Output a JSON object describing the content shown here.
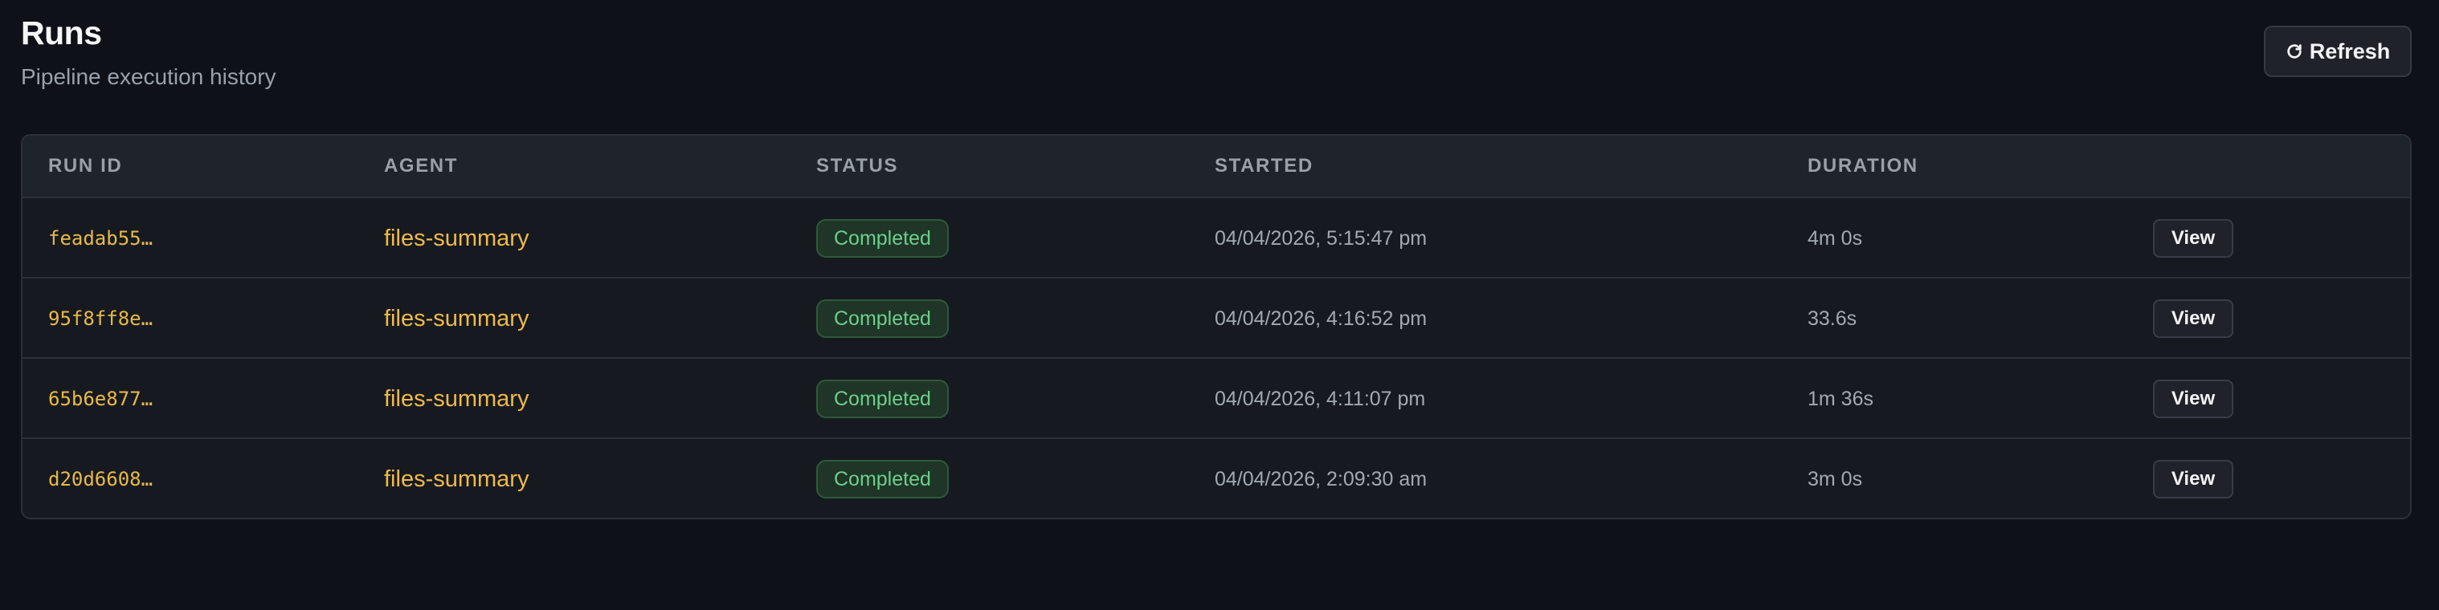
{
  "header": {
    "title": "Runs",
    "subtitle": "Pipeline execution history",
    "refresh_label": "Refresh",
    "refresh_icon": "refresh-icon"
  },
  "table": {
    "columns": [
      "RUN ID",
      "AGENT",
      "STATUS",
      "STARTED",
      "DURATION"
    ],
    "rows": [
      {
        "run_id": "feadab55…",
        "agent": "files-summary",
        "status": "Completed",
        "started": "04/04/2026, 5:15:47 pm",
        "duration": "4m 0s",
        "action": "View"
      },
      {
        "run_id": "95f8ff8e…",
        "agent": "files-summary",
        "status": "Completed",
        "started": "04/04/2026, 4:16:52 pm",
        "duration": "33.6s",
        "action": "View"
      },
      {
        "run_id": "65b6e877…",
        "agent": "files-summary",
        "status": "Completed",
        "started": "04/04/2026, 4:11:07 pm",
        "duration": "1m 36s",
        "action": "View"
      },
      {
        "run_id": "d20d6608…",
        "agent": "files-summary",
        "status": "Completed",
        "started": "04/04/2026, 2:09:30 am",
        "duration": "3m 0s",
        "action": "View"
      }
    ]
  },
  "colors": {
    "background": "#0e1117",
    "accent": "#f0b94a",
    "status_completed": "#6bd08a"
  }
}
